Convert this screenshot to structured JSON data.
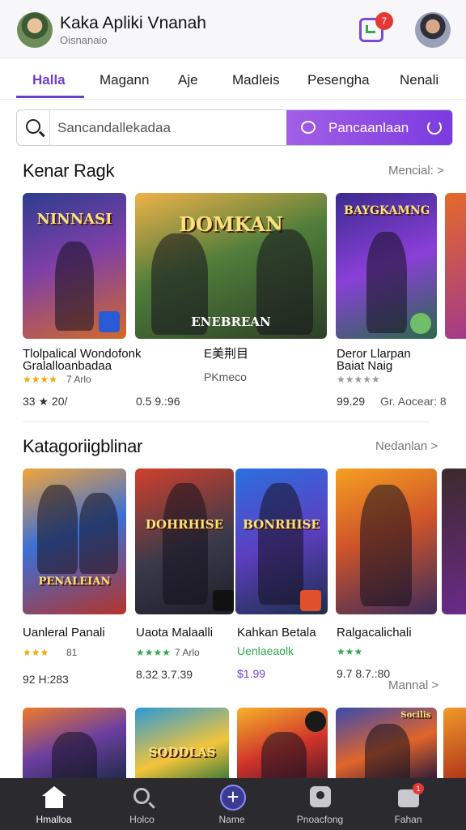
{
  "header": {
    "title": "Kaka Apliki Vnanah",
    "subtitle": "Oisnanaio",
    "notification_count": "7"
  },
  "tabs": [
    {
      "label": "Halla",
      "active": true
    },
    {
      "label": "Magann"
    },
    {
      "label": "Aje"
    },
    {
      "label": "Madleis"
    },
    {
      "label": "Pesengha"
    },
    {
      "label": "Nenali"
    }
  ],
  "search": {
    "placeholder": "Sancandallekadaa",
    "button_label": "Pancaanlaan"
  },
  "section_featured": {
    "title": "Kenar Ragk",
    "see_all": "Mencial: >",
    "cards": [
      {
        "banner": "NINNASI",
        "title_1": "Tlolpalical Wondofonk",
        "title_2": "Gralalloanbadaa",
        "stars": "★★★★",
        "rating_text": "7 Arlo",
        "price": "33 ★ 20/"
      },
      {
        "banner": "DOMKAN",
        "badge": "ENEBREAN",
        "title_1": "E美荆目",
        "subtitle": "PKmeco",
        "price": "0.5 9.:96"
      },
      {
        "banner": "BAYGKAMNG",
        "title_1": "Deror Llarpan",
        "title_2": "Baiat Naig",
        "stars": "★★★★★",
        "price": "99.29",
        "extra": "Gr. Aocear: 8"
      }
    ]
  },
  "section_categories": {
    "title": "Katagoriigblinar",
    "see_all": "Nedanlan >",
    "cards": [
      {
        "banner": "PENALEIAN",
        "title": "Uanleral Panali",
        "stars": "★★★",
        "rating_text": "81",
        "price": "92 H:283"
      },
      {
        "banner": "DOHRHISE",
        "title": "Uaota Malaalli",
        "stars": "★★★★",
        "rating_text": "7 Arlo",
        "price": "8.32 3.7.39"
      },
      {
        "banner": "BONRHISE",
        "title": "Kahkan Betala",
        "subtitle": "Uenlaeaolk",
        "price": "$1.99"
      },
      {
        "title": "Ralgacalichali",
        "stars": "★★★",
        "price": "9.7 8.7.:80",
        "more": "Mannal >"
      }
    ]
  },
  "section_third": {
    "cards": [
      {
        "banner": ""
      },
      {
        "banner": "SODDLAS"
      },
      {
        "banner": ""
      },
      {
        "banner": "Socilis"
      }
    ]
  },
  "bottom_nav": [
    {
      "label": "Hmalloa",
      "icon": "home-icon",
      "active": true
    },
    {
      "label": "Holco",
      "icon": "search-icon"
    },
    {
      "label": "Name",
      "icon": "add-icon"
    },
    {
      "label": "Pnoacfong",
      "icon": "person-icon"
    },
    {
      "label": "Fahan",
      "icon": "inbox-icon",
      "badge": "1"
    }
  ],
  "colors": {
    "accent": "#6d3fd1",
    "search_button": "#8c45e0",
    "rating_yellow": "#f2a900",
    "rating_green": "#2fa84f",
    "nav_bg": "#2b2b2f"
  }
}
